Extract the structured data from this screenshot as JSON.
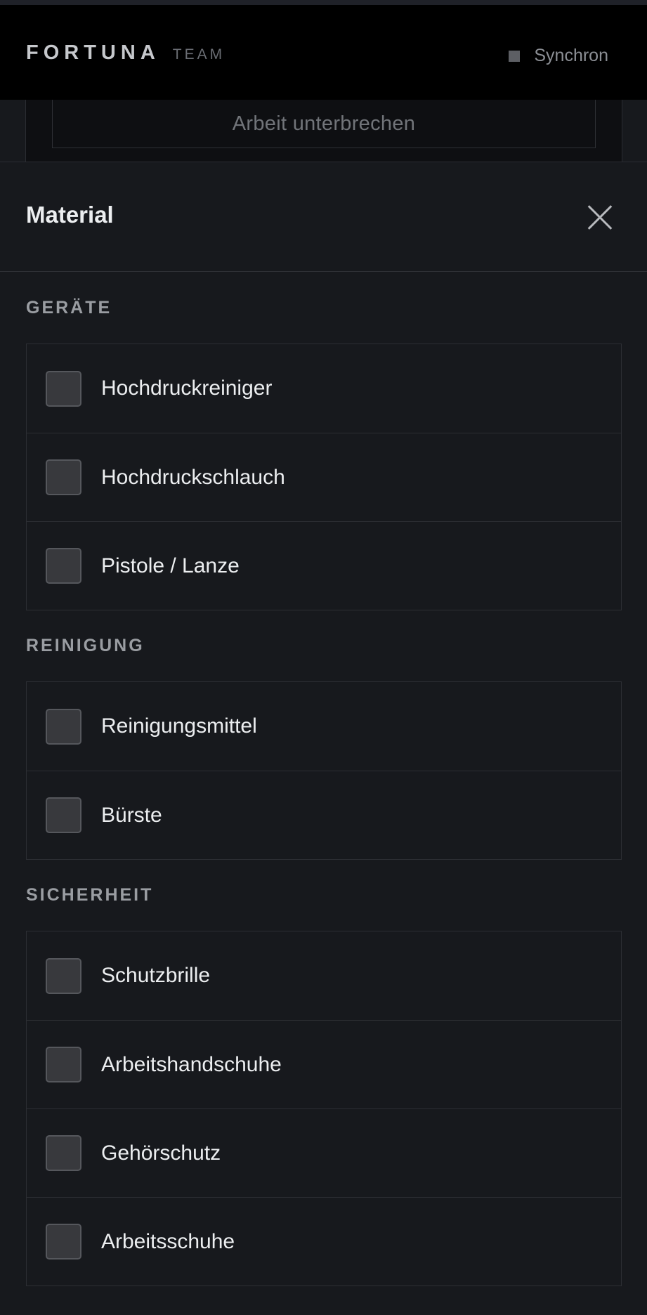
{
  "header": {
    "brand": "FORTUNA",
    "brand_sub": "TEAM",
    "sync_label": "Synchron"
  },
  "background": {
    "pause_button_label": "Arbeit unterbrechen"
  },
  "sheet": {
    "title": "Material",
    "groups": [
      {
        "title": "GERÄTE",
        "items": [
          {
            "label": "Hochdruckreiniger",
            "checked": false
          },
          {
            "label": "Hochdruckschlauch",
            "checked": false
          },
          {
            "label": "Pistole / Lanze",
            "checked": false
          }
        ]
      },
      {
        "title": "REINIGUNG",
        "items": [
          {
            "label": "Reinigungsmittel",
            "checked": false
          },
          {
            "label": "Bürste",
            "checked": false
          }
        ]
      },
      {
        "title": "SICHERHEIT",
        "items": [
          {
            "label": "Schutzbrille",
            "checked": false
          },
          {
            "label": "Arbeitshandschuhe",
            "checked": false
          },
          {
            "label": "Gehörschutz",
            "checked": false
          },
          {
            "label": "Arbeitsschuhe",
            "checked": false
          }
        ]
      }
    ]
  },
  "colors": {
    "background": "#17191d",
    "header_background": "#000000",
    "checkbox_fill": "#38393d",
    "text": "#eceef0",
    "muted_text": "#9a9da2"
  }
}
